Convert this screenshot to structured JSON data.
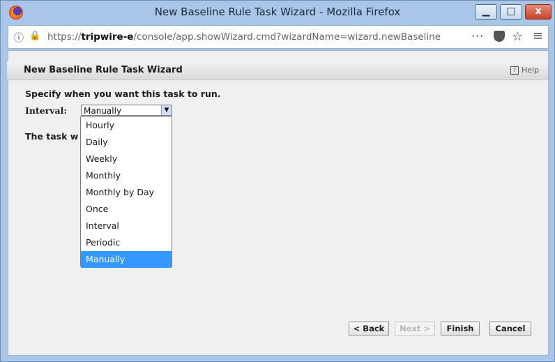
{
  "window": {
    "title": "New Baseline Rule Task Wizard - Mozilla Firefox",
    "min_glyph": "▁",
    "max_glyph": "□",
    "close_glyph": "x"
  },
  "urlbar": {
    "prefix": "https://",
    "host": "tripwire-e",
    "path": "/console/app.showWizard.cmd?wizardName=wizard.newBaseline",
    "dots": "···",
    "star": "☆",
    "menu": "≡"
  },
  "wizard": {
    "title": "New Baseline Rule Task Wizard",
    "help": "Help",
    "prompt": "Specify when you want this task to run.",
    "interval_label": "Interval:",
    "interval_value": "Manually",
    "task_text": "The task w                  y.",
    "options": [
      "Hourly",
      "Daily",
      "Weekly",
      "Monthly",
      "Monthly by Day",
      "Once",
      "Interval",
      "Periodic",
      "Manually"
    ],
    "selected_option": "Manually"
  },
  "buttons": {
    "back": "< Back",
    "next": "Next >",
    "finish": "Finish",
    "cancel": "Cancel"
  },
  "colors": {
    "selection": "#3399ff",
    "titlebar": "#a9c6e8"
  }
}
